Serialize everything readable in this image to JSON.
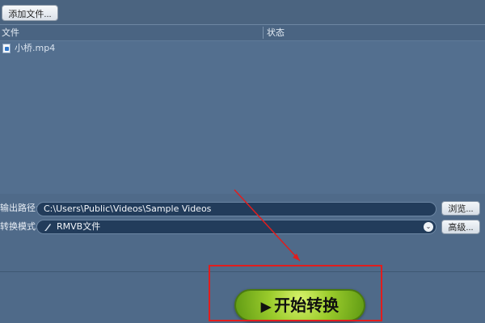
{
  "toolbar": {
    "add_file": "添加文件..."
  },
  "list": {
    "columns": [
      "文件",
      "状态"
    ],
    "files": [
      {
        "name": "小桥.mp4",
        "icon": "video-file-icon"
      }
    ]
  },
  "output": {
    "label": "输出路径:",
    "path": "C:\\Users\\Public\\Videos\\Sample Videos",
    "browse": "浏览..."
  },
  "convert": {
    "label": "转换模式:",
    "mode": "RMVB文件",
    "advanced": "高级..."
  },
  "action": {
    "start": "开始转换"
  },
  "annotation": {
    "color": "#e11d1d"
  }
}
